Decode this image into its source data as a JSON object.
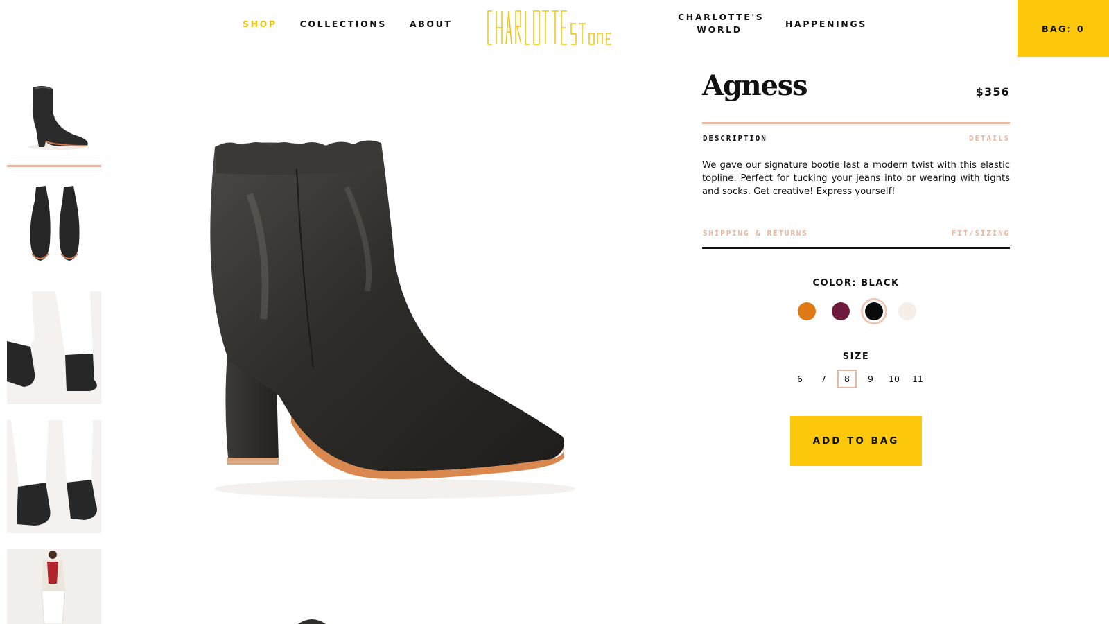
{
  "header": {
    "nav_left": [
      {
        "label": "SHOP",
        "active": true
      },
      {
        "label": "COLLECTIONS",
        "active": false
      },
      {
        "label": "ABOUT",
        "active": false
      }
    ],
    "logo_text": "CHARLOTTE STONE",
    "nav_world_line1": "CHARLOTTE'S",
    "nav_world_line2": "WORLD",
    "nav_happenings": "HAPPENINGS",
    "bag_label": "BAG: 0"
  },
  "gallery": {
    "selected_index": 0,
    "thumbnails": [
      {
        "name": "thumb-boot-side"
      },
      {
        "name": "thumb-boots-pair"
      },
      {
        "name": "thumb-worn-side"
      },
      {
        "name": "thumb-worn-front"
      },
      {
        "name": "thumb-model-full"
      }
    ]
  },
  "product": {
    "name": "Agness",
    "price": "$356",
    "tabs": {
      "description": "DESCRIPTION",
      "details": "DETAILS",
      "shipping": "SHIPPING & RETURNS",
      "fit": "FIT/SIZING"
    },
    "description_text": "We gave our signature bootie last a modern twist with this elastic topline. Perfect for tucking your jeans into or wearing with tights and socks. Get creative! Express yourself!",
    "color_label": "COLOR: BLACK",
    "colors": [
      {
        "name": "orange",
        "hex": "#e07a15"
      },
      {
        "name": "burgundy",
        "hex": "#6e1a3c"
      },
      {
        "name": "black",
        "hex": "#0a0a0a",
        "selected": true
      },
      {
        "name": "cream",
        "hex": "#f6eee8"
      }
    ],
    "size_label": "SIZE",
    "sizes": [
      "6",
      "7",
      "8",
      "9",
      "10",
      "11"
    ],
    "selected_size": "8",
    "add_to_bag": "ADD TO BAG"
  },
  "colors": {
    "accent_yellow": "#fdc70b",
    "accent_peach": "#e8b7a0"
  }
}
